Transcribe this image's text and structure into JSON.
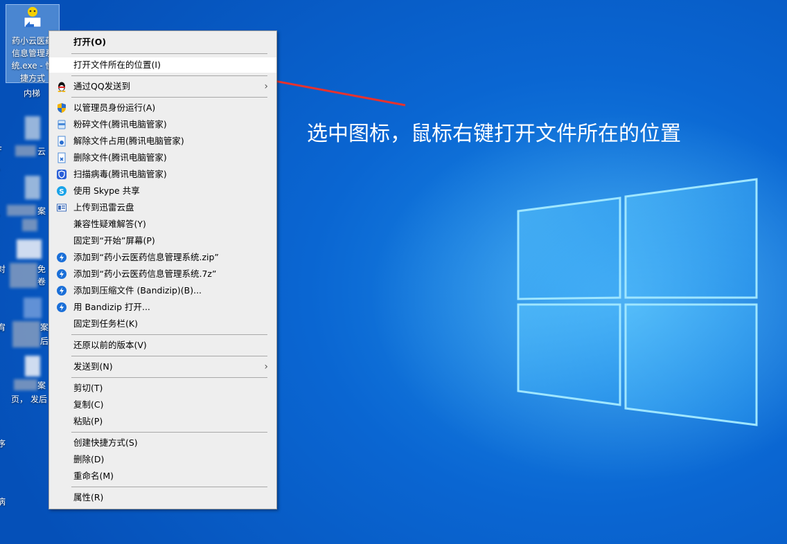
{
  "desktop": {
    "selected_icon": {
      "label_lines": [
        "药小云医药",
        "信息管理系",
        "统.exe - 快",
        "捷方式"
      ]
    },
    "icon_under": "内梯",
    "partial_labels": [
      "云",
      "案",
      "免",
      "卷",
      "案",
      "后",
      "案",
      "页，",
      "发后"
    ],
    "left_edge_chars": [
      "F",
      "、",
      "、",
      "对",
      "宥",
      "序",
      "病"
    ]
  },
  "annotation": {
    "text": "选中图标，鼠标右键打开文件所在的位置"
  },
  "context_menu": {
    "items": [
      {
        "label": "打开(O)",
        "bold": true,
        "icon": ""
      },
      {
        "label": "打开文件所在的位置(I)",
        "highlighted": true,
        "icon": ""
      },
      {
        "label": "通过QQ发送到",
        "icon": "qq-penguin-icon",
        "submenu": true
      },
      {
        "label": "以管理员身份运行(A)",
        "icon": "uac-shield-icon"
      },
      {
        "label": "粉碎文件(腾讯电脑管家)",
        "icon": "shredder-icon"
      },
      {
        "label": "解除文件占用(腾讯电脑管家)",
        "icon": "unlock-file-icon"
      },
      {
        "label": "删除文件(腾讯电脑管家)",
        "icon": "delete-file-icon"
      },
      {
        "label": "扫描病毒(腾讯电脑管家)",
        "icon": "virus-scan-shield-icon"
      },
      {
        "label": "使用 Skype 共享",
        "icon": "skype-icon"
      },
      {
        "label": "上传到迅雷云盘",
        "icon": "xunlei-cloud-icon"
      },
      {
        "label": "兼容性疑难解答(Y)",
        "icon": ""
      },
      {
        "label": "固定到“开始”屏幕(P)",
        "icon": ""
      },
      {
        "label": "添加到“药小云医药信息管理系统.zip”",
        "icon": "bandizip-icon"
      },
      {
        "label": "添加到“药小云医药信息管理系统.7z”",
        "icon": "bandizip-icon"
      },
      {
        "label": "添加到压缩文件 (Bandizip)(B)...",
        "icon": "bandizip-icon"
      },
      {
        "label": "用 Bandizip 打开...",
        "icon": "bandizip-icon"
      },
      {
        "label": "固定到任务栏(K)",
        "icon": ""
      },
      {
        "label": "还原以前的版本(V)",
        "icon": ""
      },
      {
        "label": "发送到(N)",
        "icon": "",
        "submenu": true
      },
      {
        "label": "剪切(T)",
        "icon": ""
      },
      {
        "label": "复制(C)",
        "icon": ""
      },
      {
        "label": "粘贴(P)",
        "icon": ""
      },
      {
        "label": "创建快捷方式(S)",
        "icon": ""
      },
      {
        "label": "删除(D)",
        "icon": ""
      },
      {
        "label": "重命名(M)",
        "icon": ""
      },
      {
        "label": "属性(R)",
        "icon": ""
      }
    ]
  },
  "colors": {
    "annotation_arrow": "#e8322d",
    "menu_bg": "#eeeeee",
    "desktop_blue": "#0a66d2"
  }
}
